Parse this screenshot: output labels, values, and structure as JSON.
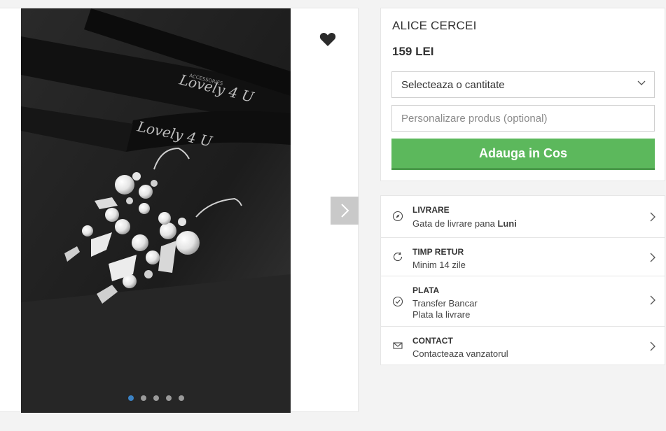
{
  "product": {
    "name": "ALICE CERCEI",
    "price": "159 LEI",
    "quantity_select": "Selecteaza o cantitate",
    "personalize_placeholder": "Personalizare produs (optional)",
    "add_to_cart": "Adauga in Cos"
  },
  "gallery": {
    "slide_count": 5,
    "active_slide": 1,
    "ribbon_text": "Lovely 4 U",
    "ribbon_subtext": "ACCESSORIES"
  },
  "info": {
    "delivery": {
      "title": "LIVRARE",
      "text": "Gata de livrare pana ",
      "text_bold": "Luni"
    },
    "returns": {
      "title": "TIMP RETUR",
      "text": "Minim 14 zile"
    },
    "payment": {
      "title": "PLATA",
      "line1": "Transfer Bancar",
      "line2": "Plata la livrare"
    },
    "contact": {
      "title": "CONTACT",
      "text": "Contacteaza vanzatorul"
    }
  },
  "colors": {
    "accent_green": "#5cb85c",
    "active_dot": "#3b82c4"
  }
}
